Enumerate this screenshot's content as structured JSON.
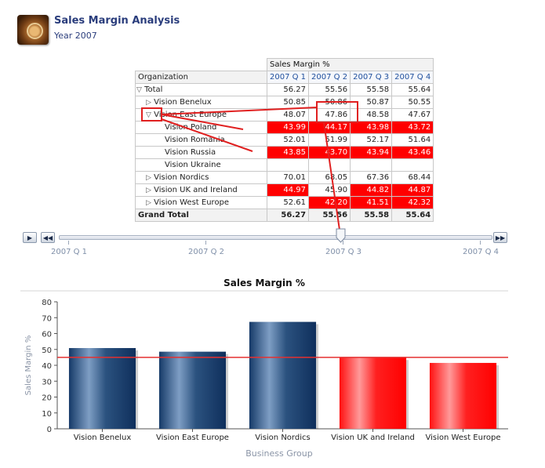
{
  "header": {
    "title": "Sales Margin Analysis",
    "subtitle": "Year 2007",
    "icon": "compass-icon"
  },
  "pivot": {
    "measure_label": "Sales Margin %",
    "org_header": "Organization",
    "quarters": [
      "2007 Q 1",
      "2007 Q 2",
      "2007 Q 3",
      "2007 Q 4"
    ],
    "rows": [
      {
        "label": "Total",
        "level": 0,
        "toggle": "expanded",
        "values": [
          "56.27",
          "55.56",
          "55.58",
          "55.64"
        ],
        "flags": [
          false,
          false,
          false,
          false
        ]
      },
      {
        "label": "Vision Benelux",
        "level": 1,
        "toggle": "collapsed",
        "values": [
          "50.85",
          "50.86",
          "50.87",
          "50.55"
        ],
        "flags": [
          false,
          false,
          false,
          false
        ]
      },
      {
        "label": "Vision East Europe",
        "level": 1,
        "toggle": "expanded",
        "values": [
          "48.07",
          "47.86",
          "48.58",
          "47.67"
        ],
        "flags": [
          false,
          false,
          false,
          false
        ]
      },
      {
        "label": "Vision Poland",
        "level": 2,
        "toggle": "none",
        "values": [
          "43.99",
          "44.17",
          "43.98",
          "43.72"
        ],
        "flags": [
          true,
          true,
          true,
          true
        ]
      },
      {
        "label": "Vision Romania",
        "level": 2,
        "toggle": "none",
        "values": [
          "52.01",
          "51.99",
          "52.17",
          "51.64"
        ],
        "flags": [
          false,
          false,
          false,
          false
        ]
      },
      {
        "label": "Vision Russia",
        "level": 2,
        "toggle": "none",
        "values": [
          "43.85",
          "43.70",
          "43.94",
          "43.46"
        ],
        "flags": [
          true,
          true,
          true,
          true
        ]
      },
      {
        "label": "Vision Ukraine",
        "level": 2,
        "toggle": "none",
        "values": [
          "",
          "",
          "",
          ""
        ],
        "flags": [
          false,
          false,
          false,
          false
        ]
      },
      {
        "label": "Vision Nordics",
        "level": 1,
        "toggle": "collapsed",
        "values": [
          "70.01",
          "68.05",
          "67.36",
          "68.44"
        ],
        "flags": [
          false,
          false,
          false,
          false
        ]
      },
      {
        "label": "Vision UK and Ireland",
        "level": 1,
        "toggle": "collapsed",
        "values": [
          "44.97",
          "45.90",
          "44.82",
          "44.87"
        ],
        "flags": [
          true,
          false,
          true,
          true
        ]
      },
      {
        "label": "Vision West Europe",
        "level": 1,
        "toggle": "collapsed",
        "values": [
          "52.61",
          "42.20",
          "41.51",
          "42.32"
        ],
        "flags": [
          false,
          true,
          true,
          true
        ]
      }
    ],
    "grand_total": {
      "label": "Grand Total",
      "values": [
        "56.27",
        "55.56",
        "55.58",
        "55.64"
      ]
    },
    "highlight_color": "#ff0000"
  },
  "slider": {
    "labels": [
      "2007 Q 1",
      "2007 Q 2",
      "2007 Q 3",
      "2007 Q 4"
    ],
    "selected": "2007 Q 3",
    "play_icon": "play-icon",
    "back_icon": "rewind-icon",
    "forward_icon": "fast-forward-icon"
  },
  "annotations": {
    "color": "#e02020"
  },
  "chart_data": {
    "type": "bar",
    "title": "Sales Margin %",
    "xlabel": "Business Group",
    "ylabel": "Sales Margin %",
    "ylim": [
      0,
      80
    ],
    "yticks": [
      0,
      10,
      20,
      30,
      40,
      50,
      60,
      70,
      80
    ],
    "categories": [
      "Vision Benelux",
      "Vision East Europe",
      "Vision Nordics",
      "Vision UK and Ireland",
      "Vision West Europe"
    ],
    "values": [
      50.87,
      48.58,
      67.36,
      44.82,
      41.51
    ],
    "threshold": 45,
    "colors": {
      "above": "#1f4677",
      "below": "#ff0000",
      "threshold_line": "#e53030"
    },
    "grid": false
  }
}
